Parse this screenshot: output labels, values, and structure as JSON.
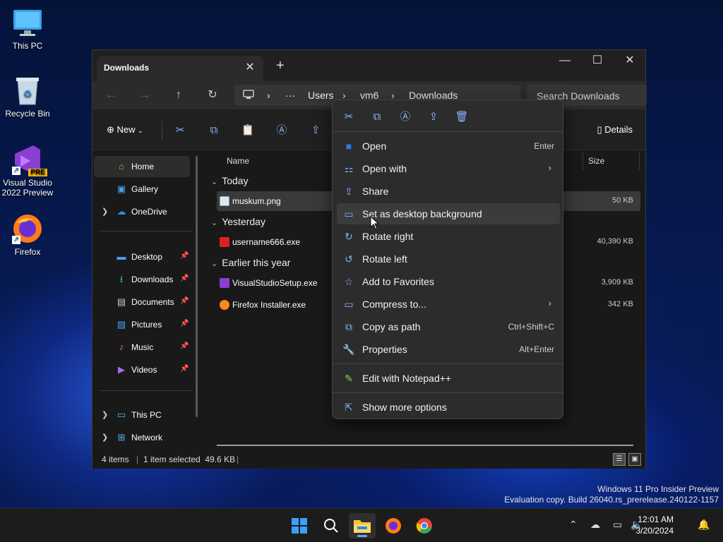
{
  "desktop": {
    "icons": [
      {
        "label": "This PC",
        "icon": "this-pc-icon"
      },
      {
        "label": "Recycle Bin",
        "icon": "recycle-bin-icon"
      },
      {
        "label": "Visual Studio 2022 Preview",
        "icon": "visual-studio-icon",
        "badge": "PRE"
      },
      {
        "label": "Firefox",
        "icon": "firefox-icon"
      }
    ],
    "watermark": {
      "line1": "Windows 11 Pro Insider Preview",
      "line2": "Evaluation copy. Build 26040.rs_prerelease.240122-1157"
    }
  },
  "explorer": {
    "tab": {
      "title": "Downloads",
      "close": "✕",
      "add": "+"
    },
    "window_controls": {
      "minimize": "—",
      "maximize": "☐",
      "close": "✕"
    },
    "nav": {
      "back": "←",
      "forward": "→",
      "up": "↑",
      "refresh": "↻"
    },
    "address": {
      "crumbs": [
        "Users",
        "vm6",
        "Downloads"
      ],
      "more": "···",
      "separator": "›"
    },
    "search": {
      "placeholder": "Search Downloads"
    },
    "toolbar": {
      "new_label": "New",
      "details_label": "Details"
    },
    "sidebar": {
      "items": [
        {
          "label": "Home",
          "icon": "home-icon",
          "active": true
        },
        {
          "label": "Gallery",
          "icon": "gallery-icon"
        },
        {
          "label": "OneDrive",
          "icon": "onedrive-icon",
          "expandable": true
        },
        {
          "label": "Desktop",
          "icon": "desktop-folder-icon",
          "pinned": true
        },
        {
          "label": "Downloads",
          "icon": "downloads-folder-icon",
          "pinned": true
        },
        {
          "label": "Documents",
          "icon": "documents-folder-icon",
          "pinned": true
        },
        {
          "label": "Pictures",
          "icon": "pictures-folder-icon",
          "pinned": true
        },
        {
          "label": "Music",
          "icon": "music-folder-icon",
          "pinned": true
        },
        {
          "label": "Videos",
          "icon": "videos-folder-icon",
          "pinned": true
        },
        {
          "label": "This PC",
          "icon": "this-pc-icon",
          "expandable": true
        },
        {
          "label": "Network",
          "icon": "network-icon",
          "expandable": true
        }
      ]
    },
    "columns": {
      "name": "Name",
      "size": "Size"
    },
    "groups": [
      {
        "label": "Today",
        "files": [
          {
            "name": "muskum.png",
            "size": "50 KB",
            "selected": true
          }
        ]
      },
      {
        "label": "Yesterday",
        "files": [
          {
            "name": "username666.exe",
            "size": "40,390 KB"
          }
        ]
      },
      {
        "label": "Earlier this year",
        "files": [
          {
            "name": "VisualStudioSetup.exe",
            "size": "3,909 KB"
          },
          {
            "name": "Firefox Installer.exe",
            "size": "342 KB"
          }
        ]
      }
    ],
    "status": {
      "count": "4 items",
      "selection": "1 item selected  49.6 KB"
    }
  },
  "context_menu": {
    "items": [
      {
        "label": "Open",
        "shortcut": "Enter",
        "icon": "open-icon"
      },
      {
        "label": "Open with",
        "submenu": true,
        "icon": "open-with-icon"
      },
      {
        "label": "Share",
        "icon": "share-icon"
      },
      {
        "label": "Set as desktop background",
        "icon": "desktop-background-icon",
        "hover": true
      },
      {
        "label": "Rotate right",
        "icon": "rotate-right-icon"
      },
      {
        "label": "Rotate left",
        "icon": "rotate-left-icon"
      },
      {
        "label": "Add to Favorites",
        "icon": "star-icon"
      },
      {
        "label": "Compress to...",
        "submenu": true,
        "icon": "compress-icon"
      },
      {
        "label": "Copy as path",
        "shortcut": "Ctrl+Shift+C",
        "icon": "copy-path-icon"
      },
      {
        "label": "Properties",
        "shortcut": "Alt+Enter",
        "icon": "properties-icon"
      },
      {
        "label": "Edit with Notepad++",
        "icon": "notepadpp-icon"
      },
      {
        "label": "Show more options",
        "icon": "more-options-icon"
      }
    ]
  },
  "taskbar": {
    "apps": [
      "start-icon",
      "search-icon",
      "file-explorer-icon",
      "firefox-icon",
      "chrome-icon"
    ],
    "clock": {
      "time": "12:01 AM",
      "date": "3/20/2024"
    }
  },
  "colors": {
    "accent": "#6aa5ff",
    "menu_bg": "#2c2c2c",
    "window_bg": "#191919"
  }
}
